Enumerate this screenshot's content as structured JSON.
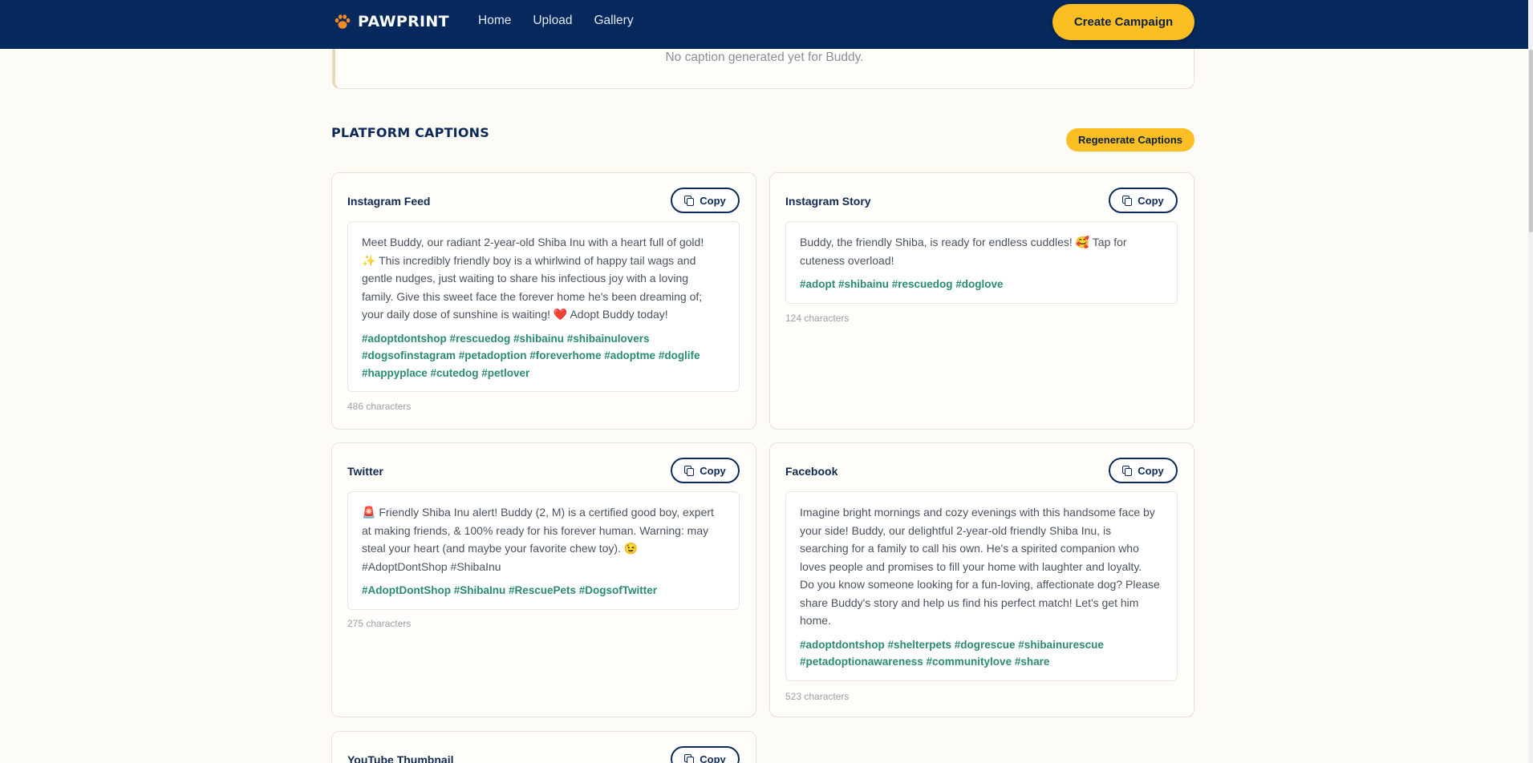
{
  "nav": {
    "brand": "PAWPRINT",
    "links": [
      "Home",
      "Upload",
      "Gallery"
    ],
    "cta": "Create Campaign"
  },
  "top_card": {
    "message": "No caption generated yet for Buddy."
  },
  "section": {
    "title": "PLATFORM CAPTIONS",
    "regenerate_label": "Regenerate Captions"
  },
  "copy_label": "Copy",
  "cards": [
    {
      "title": "Instagram Feed",
      "caption_lines": [
        "Meet Buddy, our radiant 2-year-old Shiba Inu with a heart full of gold!",
        "✨ This incredibly friendly boy is a whirlwind of happy tail wags and",
        "gentle nudges, just waiting to share his infectious joy with a loving",
        "family. Give this sweet face the forever home he's been dreaming of;",
        "your daily dose of sunshine is waiting! ❤️ Adopt Buddy today!"
      ],
      "hashtag_lines": [
        "#adoptdontshop #rescuedog #shibainu #shibainulovers",
        "#dogsofinstagram #petadoption #foreverhome #adoptme #doglife",
        "#happyplace #cutedog #petlover"
      ],
      "char_count": "486 characters"
    },
    {
      "title": "Instagram Story",
      "caption_lines": [
        "Buddy, the friendly Shiba, is ready for endless cuddles! 🥰 Tap for",
        "cuteness overload!"
      ],
      "hashtag_lines": [
        "#adopt #shibainu #rescuedog #doglove"
      ],
      "char_count": "124 characters"
    },
    {
      "title": "Twitter",
      "caption_lines": [
        "🚨 Friendly Shiba Inu alert! Buddy (2, M) is a certified good boy, expert",
        "at making friends, & 100% ready for his forever human. Warning: may",
        "steal your heart (and maybe your favorite chew toy). 😉",
        "#AdoptDontShop #ShibaInu"
      ],
      "hashtag_lines": [
        "#AdoptDontShop #ShibaInu #RescuePets #DogsofTwitter"
      ],
      "char_count": "275 characters"
    },
    {
      "title": "Facebook",
      "caption_lines": [
        "Imagine bright mornings and cozy evenings with this handsome face by",
        "your side! Buddy, our delightful 2-year-old friendly Shiba Inu, is",
        "searching for a family to call his own. He's a spirited companion who",
        "loves people and promises to fill your home with laughter and loyalty.",
        "Do you know someone looking for a fun-loving, affectionate dog? Please",
        "share Buddy's story and help us find his perfect match! Let's get him",
        "home."
      ],
      "hashtag_lines": [
        "#adoptdontshop #shelterpets #dogrescue #shibainurescue",
        "#petadoptionawareness #communitylove #share"
      ],
      "char_count": "523 characters"
    },
    {
      "title": "YouTube Thumbnail"
    }
  ],
  "colors": {
    "nav_bg": "#05295d",
    "accent": "#fbbf24",
    "hashtag": "#2b8a74",
    "page_bg": "#fcfbf6"
  },
  "icons": {
    "brand": "paw-icon",
    "copy": "copy-icon"
  }
}
